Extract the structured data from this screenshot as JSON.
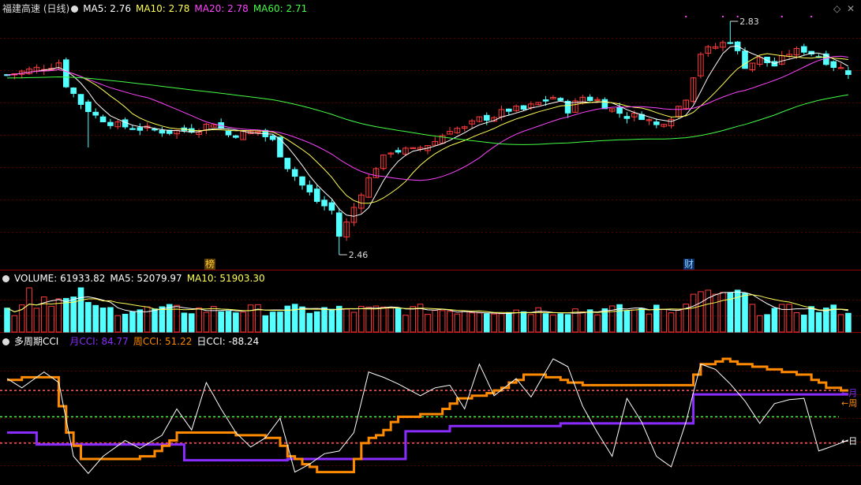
{
  "price_panel": {
    "title": "福建高速 (日线)",
    "ma5": "MA5: 2.76",
    "ma10": "MA10: 2.78",
    "ma20": "MA20: 2.78",
    "ma60": "MA60: 2.71",
    "marker_bang": "榜",
    "marker_cai": "财"
  },
  "volume_panel": {
    "title": "VOLUME: 61933.82",
    "ma5": "MA5: 52079.97",
    "ma10": "MA10: 51903.30"
  },
  "cci_panel": {
    "title": "多周期CCI",
    "month": "月CCI: 84.77",
    "week": "周CCI: 51.22",
    "day": "日CCI: -88.24",
    "label_month": "←月",
    "label_week": "←周",
    "label_day": "←日"
  },
  "colors": {
    "up": "#ff3b3b",
    "down": "#54ffff",
    "ma5": "#ffffff",
    "ma10": "#ffff55",
    "ma20": "#ff44ff",
    "ma60": "#44ff44",
    "cci_month": "#8b2cff",
    "cci_week": "#ff8a00",
    "cci_day": "#ffffff"
  },
  "chart_data": {
    "type": "candlestick",
    "price_high_label": "2.83",
    "price_low_label": "2.46",
    "price_high": 2.83,
    "price_low": 2.46,
    "candle_count": 115,
    "cci_levels": [
      100,
      0,
      -100
    ]
  }
}
